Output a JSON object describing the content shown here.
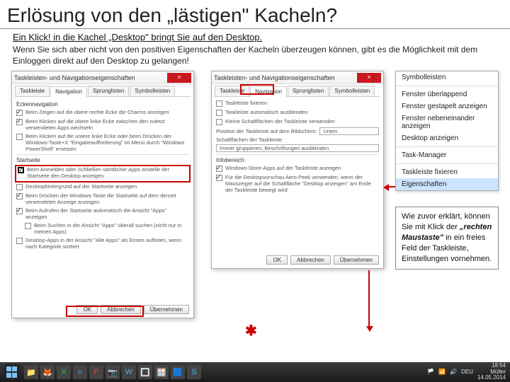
{
  "slide": {
    "title": "Erlösung von den „lästigen\" Kacheln?",
    "subtitle": "Ein Klick! in die Kachel „Desktop\" bringt Sie auf den Desktop.",
    "body": "Wenn Sie sich aber nicht von den positiven Eigenschaften der Kacheln überzeugen können, gibt es die Möglichkeit mit dem Einloggen direkt auf den Desktop zu gelangen!"
  },
  "dialog_left": {
    "title": "Taskleisten- und Navigationseigenschaften",
    "tabs": [
      "Taskleiste",
      "Navigation",
      "Sprunglisten",
      "Symbolleisten"
    ],
    "active_tab": 1,
    "section_corner": "Eckennavigation",
    "opt1": "Beim Zeigen auf die obere rechte Ecke die Charms anzeigen",
    "opt2": "Beim Klicken auf die obere linke Ecke zwischen den zuletzt verwendeten Apps wechseln",
    "opt3": "Beim Klicken auf die untere linke Ecke oder beim Drücken der Windows-Taste+X \"Eingabeaufforderung\" im Menü durch \"Windows PowerShell\" ersetzen",
    "section_start": "Startseite",
    "opt4": "Beim Anmelden oder Schließen sämtlicher Apps anstelle der Startseite den Desktop anzeigen",
    "opt5": "Desktophintergrund auf der Startseite anzeigen",
    "opt6": "Beim Drücken der Windows-Taste die Startseite auf dem derzeit verwendeten Anzeige anzeigen",
    "opt7": "Beim Aufrufen der Startseite automatisch die Ansicht \"Apps\" anzeigen",
    "opt8": "Beim Suchen in der Ansicht \"Apps\" überall suchen (nicht nur in meinen Apps)",
    "opt9": "Desktop-Apps in der Ansicht \"Alle Apps\" als Erstes auflisten, wenn nach Kategorie sortiert"
  },
  "dialog_mid": {
    "title": "Taskleisten- und Navigationseigenschaften",
    "tabs": [
      "Taskleiste",
      "Navigation",
      "Sprunglisten",
      "Symbolleisten"
    ],
    "active_tab": 1,
    "opt1": "Taskleiste fixieren",
    "opt2": "Taskleiste automatisch ausblenden",
    "opt3": "Kleine Schaltflächen der Taskleiste verwenden",
    "lbl_pos": "Position der Taskleiste auf dem Bildschirm:",
    "val_pos": "Unten",
    "lbl_grp": "Schaltflächen der Taskleiste:",
    "val_grp": "Immer gruppieren, Beschriftungen ausblenden",
    "section_corner": "Infobereich:",
    "opt4": "Windows-Store-Apps auf der Taskleiste anzeigen",
    "opt5": "Für die Desktopvorschau Aero Peek verwenden, wenn der Mauszeiger auf die Schaltfläche \"Desktop anzeigen\" am Ende der Taskleiste bewegt wird"
  },
  "context_menu": {
    "items": [
      "Symbolleisten",
      "Fenster überlappend",
      "Fenster gestapelt anzeigen",
      "Fenster nebeneinander anzeigen",
      "Desktop anzeigen",
      "Task-Manager",
      "Taskleiste fixieren",
      "Eigenschaften"
    ]
  },
  "explain": {
    "text1": "Wie zuvor erklärt, können Sie mit Klick der ",
    "text_em": "„rechten Maustaste\"",
    "text2": " in ein freies Feld der Taskleiste, Einstellungen vornehmen."
  },
  "buttons": {
    "ok": "OK",
    "cancel": "Abbrechen",
    "apply": "Übernehmen"
  },
  "tray": {
    "lang": "DEU",
    "time": "18:54",
    "date": "14.05.2014",
    "user": "Müller"
  }
}
